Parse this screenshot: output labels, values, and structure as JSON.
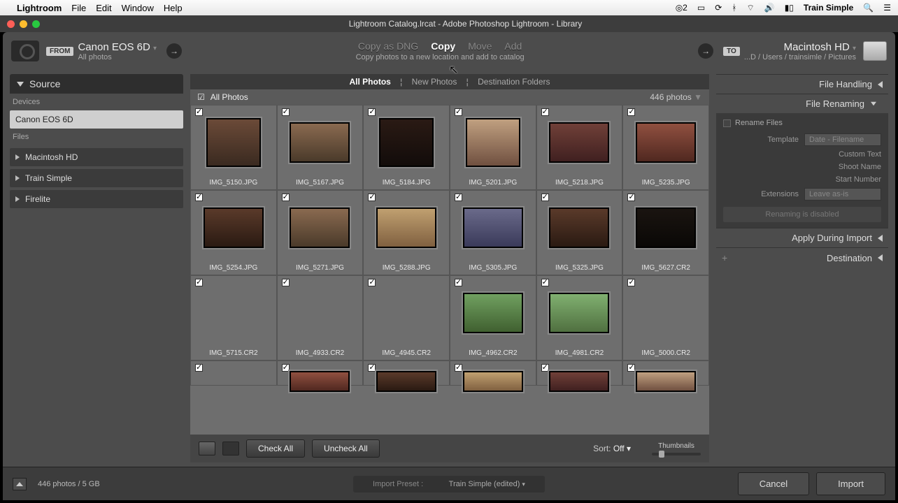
{
  "menubar": {
    "app": "Lightroom",
    "items": [
      "File",
      "Edit",
      "Window",
      "Help"
    ],
    "right": {
      "count": "2",
      "user": "Train Simple"
    }
  },
  "window": {
    "title": "Lightroom Catalog.lrcat - Adobe Photoshop Lightroom - Library"
  },
  "header": {
    "from_badge": "FROM",
    "from_device": "Canon EOS 6D",
    "from_sub": "All photos",
    "modes": {
      "dng": "Copy as DNG",
      "copy": "Copy",
      "move": "Move",
      "add": "Add"
    },
    "subtitle": "Copy photos to a new location and add to catalog",
    "to_badge": "TO",
    "to_device": "Macintosh HD",
    "to_sub": "...D / Users / trainsimle / Pictures"
  },
  "source": {
    "title": "Source",
    "devices_label": "Devices",
    "device": "Canon EOS 6D",
    "files_label": "Files",
    "volumes": [
      "Macintosh HD",
      "Train Simple",
      "Firelite"
    ]
  },
  "tabs": {
    "all": "All Photos",
    "new": "New Photos",
    "dest": "Destination Folders"
  },
  "group": {
    "title": "All Photos",
    "count": "446 photos"
  },
  "grid": [
    {
      "name": "IMG_5150.JPG",
      "cls": "p1",
      "wide": false
    },
    {
      "name": "IMG_5167.JPG",
      "cls": "p2",
      "wide": true
    },
    {
      "name": "IMG_5184.JPG",
      "cls": "p3",
      "wide": false
    },
    {
      "name": "IMG_5201.JPG",
      "cls": "p4",
      "wide": false
    },
    {
      "name": "IMG_5218.JPG",
      "cls": "p5",
      "wide": true
    },
    {
      "name": "IMG_5235.JPG",
      "cls": "p6",
      "wide": true
    },
    {
      "name": "IMG_5254.JPG",
      "cls": "p7",
      "wide": true
    },
    {
      "name": "IMG_5271.JPG",
      "cls": "p2",
      "wide": true
    },
    {
      "name": "IMG_5288.JPG",
      "cls": "p8",
      "wide": true
    },
    {
      "name": "IMG_5305.JPG",
      "cls": "p9",
      "wide": true
    },
    {
      "name": "IMG_5325.JPG",
      "cls": "p7",
      "wide": true
    },
    {
      "name": "IMG_5627.CR2",
      "cls": "p10",
      "wide": true
    },
    {
      "name": "IMG_5715.CR2",
      "cls": "",
      "wide": true,
      "empty": true
    },
    {
      "name": "IMG_4933.CR2",
      "cls": "",
      "wide": true,
      "empty": true
    },
    {
      "name": "IMG_4945.CR2",
      "cls": "",
      "wide": true,
      "empty": true
    },
    {
      "name": "IMG_4962.CR2",
      "cls": "p11",
      "wide": true
    },
    {
      "name": "IMG_4981.CR2",
      "cls": "p12",
      "wide": true
    },
    {
      "name": "IMG_5000.CR2",
      "cls": "",
      "wide": true,
      "empty": true
    }
  ],
  "gridcut": [
    {
      "empty": true
    },
    {
      "cls": "p6"
    },
    {
      "cls": "p7"
    },
    {
      "cls": "p8"
    },
    {
      "cls": "p5"
    },
    {
      "cls": "p4"
    }
  ],
  "gridbar": {
    "check_all": "Check All",
    "uncheck_all": "Uncheck All",
    "sort_label": "Sort:",
    "sort_value": "Off",
    "thumbs": "Thumbnails"
  },
  "right_panels": {
    "file_handling": "File Handling",
    "file_renaming": "File Renaming",
    "rename_files": "Rename Files",
    "template_label": "Template",
    "template_value": "Date - Filename",
    "custom_text": "Custom Text",
    "shoot_name": "Shoot Name",
    "start_number": "Start Number",
    "extensions_label": "Extensions",
    "extensions_value": "Leave as-is",
    "disabled_msg": "Renaming is disabled",
    "apply_during": "Apply During Import",
    "destination": "Destination"
  },
  "footer": {
    "status": "446 photos / 5 GB",
    "preset_label": "Import Preset :",
    "preset_value": "Train Simple (edited)",
    "cancel": "Cancel",
    "import": "Import"
  }
}
